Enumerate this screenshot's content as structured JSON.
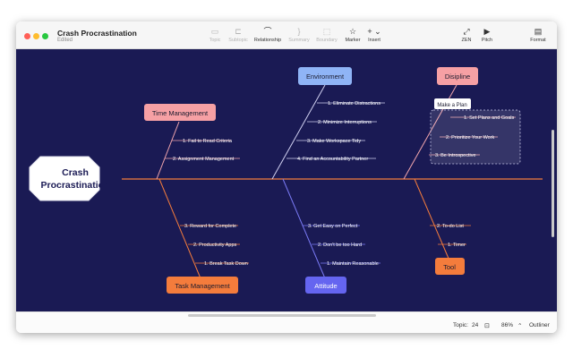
{
  "window": {
    "title": "Crash Procrastination",
    "subtitle": "Edited"
  },
  "toolbar": [
    {
      "label": "Topic",
      "icon": "topic-icon",
      "glyph": "▭",
      "enabled": false
    },
    {
      "label": "Subtopic",
      "icon": "subtopic-icon",
      "glyph": "⊏",
      "enabled": false
    },
    {
      "label": "Relationship",
      "icon": "relationship-icon",
      "glyph": "⌒",
      "enabled": true
    },
    {
      "label": "Summary",
      "icon": "summary-icon",
      "glyph": "}",
      "enabled": false
    },
    {
      "label": "Boundary",
      "icon": "boundary-icon",
      "glyph": "⬚",
      "enabled": false
    },
    {
      "label": "Marker",
      "icon": "marker-icon",
      "glyph": "☆",
      "enabled": true
    },
    {
      "label": "Insert",
      "icon": "insert-icon",
      "glyph": "+ ⌄",
      "enabled": true
    },
    {
      "label": "ZEN",
      "icon": "zen-icon",
      "glyph": "⤢",
      "enabled": true
    },
    {
      "label": "Pitch",
      "icon": "pitch-icon",
      "glyph": "▶",
      "enabled": true
    },
    {
      "label": "Format",
      "icon": "format-icon",
      "glyph": "▤",
      "enabled": true
    }
  ],
  "map": {
    "central": {
      "line1": "Crash",
      "line2": "Procrastination"
    },
    "categories": [
      {
        "label": "Time Management",
        "color": "#f6a0a4"
      },
      {
        "label": "Environment",
        "color": "#8fb4f6"
      },
      {
        "label": "Disipline",
        "color": "#f6a0a4"
      },
      {
        "label": "Task Management",
        "color": "#f47c3c"
      },
      {
        "label": "Attitude",
        "color": "#6565f0"
      },
      {
        "label": "Tool",
        "color": "#f47c3c"
      }
    ],
    "callout": "Make a Plan",
    "items": {
      "time_management": [
        "1. Fail to Read Criteria",
        "2. Assignment Management"
      ],
      "environment": [
        "1. Eliminate Distractions",
        "2. Minimize Interruptions",
        "3. Make Workspace Tidy",
        "4. Find an Accountability Partner"
      ],
      "disipline": [
        "1. Set Plans and Goals",
        "2. Prioritize Your Work",
        "3. Be Introspective"
      ],
      "task_management": [
        "3. Reward for Complete",
        "2. Productivity Apps",
        "1. Break Task Down"
      ],
      "attitude": [
        "3. Get Easy on Perfect",
        "2. Don't be too Hard",
        "1. Maintain Reasonable"
      ],
      "tool": [
        "2. To-do List",
        "1. Timer"
      ]
    }
  },
  "status": {
    "topic_label": "Topic:",
    "topic_count": "24",
    "zoom": "86%",
    "outliner": "Outliner"
  }
}
